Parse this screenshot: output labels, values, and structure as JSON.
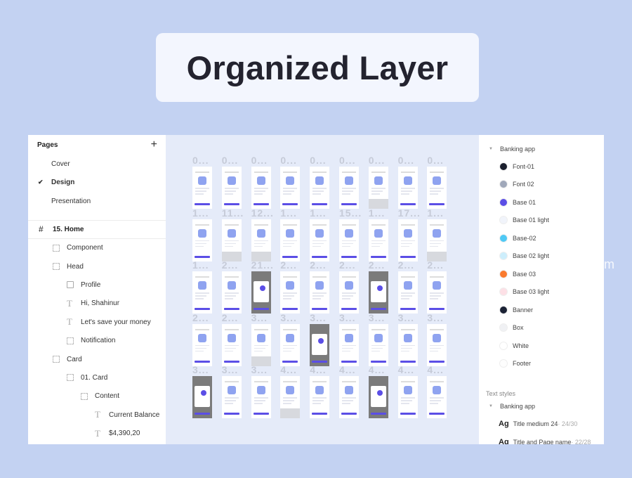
{
  "title": "Organized Layer",
  "watermark": "m",
  "pages": {
    "heading": "Pages",
    "add_icon": "plus-icon",
    "items": [
      {
        "label": "Cover",
        "selected": false
      },
      {
        "label": "Design",
        "selected": true
      },
      {
        "label": "Presentation",
        "selected": false
      }
    ]
  },
  "layers": {
    "frame": "15. Home",
    "items": [
      {
        "label": "Component",
        "icon": "frame-dots-icon",
        "depth": 1
      },
      {
        "label": "Head",
        "icon": "frame-dots-icon",
        "depth": 1
      },
      {
        "label": "Profile",
        "icon": "image-icon",
        "depth": 2
      },
      {
        "label": "Hi, Shahinur",
        "icon": "text-icon",
        "depth": 2
      },
      {
        "label": "Let's save your money",
        "icon": "text-icon",
        "depth": 2
      },
      {
        "label": "Notification",
        "icon": "frame-dots-icon",
        "depth": 2
      },
      {
        "label": "Card",
        "icon": "frame-dots-icon",
        "depth": 1
      },
      {
        "label": "01. Card",
        "icon": "frame-dots-icon",
        "depth": 2
      },
      {
        "label": "Content",
        "icon": "frame-dots-icon",
        "depth": 3
      },
      {
        "label": "Current Balance",
        "icon": "text-icon",
        "depth": 4
      },
      {
        "label": "$4,390,20",
        "icon": "text-icon",
        "depth": 4
      }
    ]
  },
  "canvas": {
    "accent": "#5b4ee6",
    "rows": [
      {
        "labels": [
          "0...",
          "0...",
          "0...",
          "0...",
          "0...",
          "0...",
          "0...",
          "0...",
          "0..."
        ],
        "kinds": [
          "w",
          "w",
          "w",
          "w",
          "w",
          "w",
          "k",
          "w",
          "w"
        ]
      },
      {
        "labels": [
          "1...",
          "11...",
          "12...",
          "1...",
          "1...",
          "15...",
          "1...",
          "17...",
          "1..."
        ],
        "kinds": [
          "w",
          "k",
          "k",
          "w",
          "w",
          "w",
          "w",
          "w",
          "k"
        ]
      },
      {
        "labels": [
          "1...",
          "2...",
          "21...",
          "2...",
          "2...",
          "2...",
          "2...",
          "2...",
          "2..."
        ],
        "kinds": [
          "w",
          "w",
          "d",
          "w",
          "w",
          "w",
          "d",
          "w",
          "w"
        ]
      },
      {
        "labels": [
          "2...",
          "2...",
          "3...",
          "3...",
          "3...",
          "3...",
          "3...",
          "3...",
          "3..."
        ],
        "kinds": [
          "w",
          "w",
          "k",
          "w",
          "d",
          "w",
          "w",
          "w",
          "w"
        ]
      },
      {
        "labels": [
          "3...",
          "3...",
          "3...",
          "4...",
          "4...",
          "4...",
          "4...",
          "4...",
          "4..."
        ],
        "kinds": [
          "d",
          "w",
          "w",
          "k",
          "w",
          "w",
          "d",
          "w",
          "w"
        ]
      }
    ]
  },
  "styles": {
    "group": "Banking app",
    "colors": [
      {
        "label": "Font-01",
        "color": "#1b1f2e"
      },
      {
        "label": "Font 02",
        "color": "#a0a8ba"
      },
      {
        "label": "Base 01",
        "color": "#5b4ee6"
      },
      {
        "label": "Base 01 light",
        "color": "#f1f4fb"
      },
      {
        "label": "Base-02",
        "color": "#4fc9f5"
      },
      {
        "label": "Base 02 light",
        "color": "#cdeefc"
      },
      {
        "label": "Base 03",
        "color": "#fa7a2e"
      },
      {
        "label": "Base 03 light",
        "color": "#fde0e6"
      },
      {
        "label": "Banner",
        "color": "#1b2235"
      },
      {
        "label": "Box",
        "color": "#f0f1f4"
      },
      {
        "label": "White",
        "color": "#ffffff"
      },
      {
        "label": "Footer",
        "color": "#fdfdfd"
      }
    ],
    "text_styles_label": "Text styles",
    "text_group": "Banking app",
    "text_styles": [
      {
        "sample": "Ag",
        "name": "Title medium 24",
        "meta": " · 24/30"
      },
      {
        "sample": "Ag",
        "name": "Title and Page name",
        "meta": " · 22/28"
      }
    ]
  }
}
